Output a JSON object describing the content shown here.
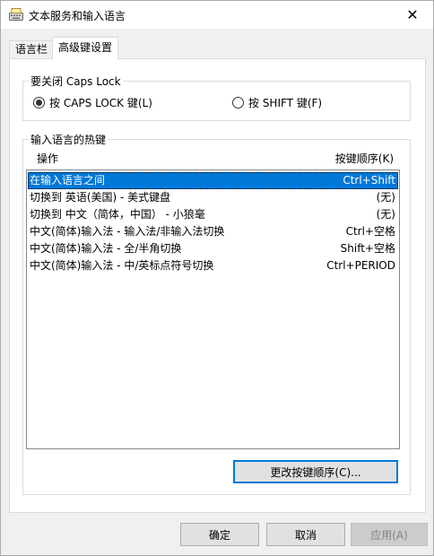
{
  "window": {
    "title": "文本服务和输入语言",
    "close_glyph": "✕"
  },
  "tabs": [
    {
      "label": "语言栏",
      "active": false
    },
    {
      "label": "高级键设置",
      "active": true
    }
  ],
  "caps_lock_group": {
    "legend": "要关闭 Caps Lock",
    "options": [
      {
        "label": "按 CAPS LOCK 键(L)",
        "checked": true
      },
      {
        "label": "按 SHIFT 键(F)",
        "checked": false
      }
    ]
  },
  "hotkeys_group": {
    "legend": "输入语言的热键",
    "col_action": "操作",
    "col_key": "按键顺序(K)",
    "rows": [
      {
        "action": "在输入语言之间",
        "key": "Ctrl+Shift",
        "selected": true
      },
      {
        "action": "切换到 英语(美国) - 美式键盘",
        "key": "(无)",
        "selected": false
      },
      {
        "action": "切换到 中文（简体，中国） - 小狼毫",
        "key": "(无)",
        "selected": false
      },
      {
        "action": "中文(简体)输入法 - 输入法/非输入法切换",
        "key": "Ctrl+空格",
        "selected": false
      },
      {
        "action": "中文(简体)输入法 - 全/半角切换",
        "key": "Shift+空格",
        "selected": false
      },
      {
        "action": "中文(简体)输入法 - 中/英标点符号切换",
        "key": "Ctrl+PERIOD",
        "selected": false
      }
    ],
    "change_button": "更改按键顺序(C)..."
  },
  "buttons": {
    "ok": "确定",
    "cancel": "取消",
    "apply": "应用(A)"
  },
  "colors": {
    "selection": "#0078d7",
    "focus_border": "#0078d7"
  }
}
